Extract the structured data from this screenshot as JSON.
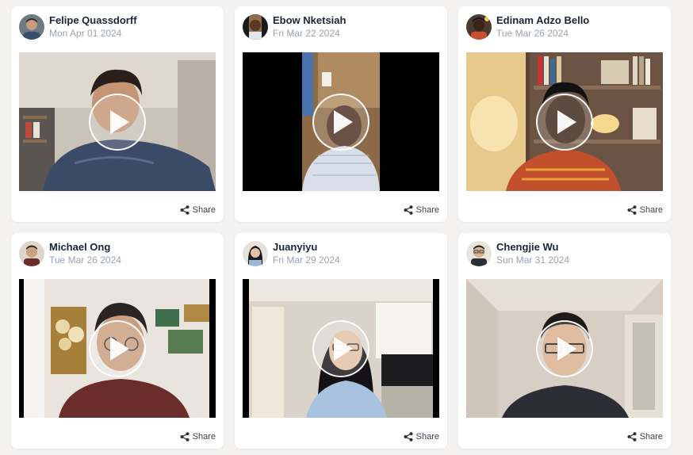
{
  "share_label": "Share",
  "cards": [
    {
      "name": "Felipe Quassdorff",
      "date": "Mon Apr 01 2024"
    },
    {
      "name": "Ebow Nketsiah",
      "date": "Fri Mar 22 2024"
    },
    {
      "name": "Edinam Adzo Bello",
      "date": "Tue Mar 26 2024"
    },
    {
      "name": "Michael Ong",
      "date": "Tue Mar 26 2024"
    },
    {
      "name": "Juanyiyu",
      "date": "Fri Mar 29 2024"
    },
    {
      "name": "Chengjie Wu",
      "date": "Sun Mar 31 2024"
    }
  ],
  "icons": {
    "play": "play-icon",
    "share": "share-icon"
  },
  "colors": {
    "background": "#f3f2f1",
    "card": "#ffffff",
    "name": "#1c2433",
    "date": "#9aa2b1"
  }
}
